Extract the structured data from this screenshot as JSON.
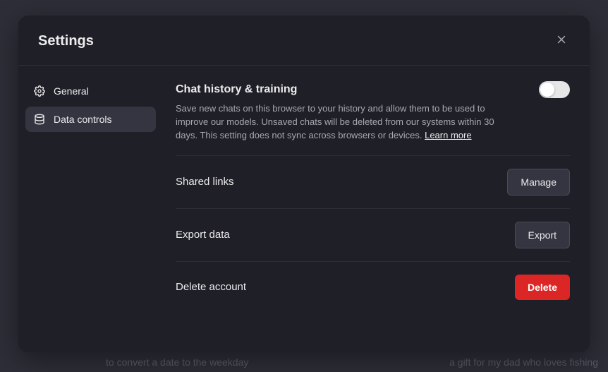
{
  "backdrop": {
    "left": "to convert a date to the weekday",
    "right": "a gift for my dad who loves fishing"
  },
  "modal": {
    "title": "Settings"
  },
  "sidebar": {
    "items": [
      {
        "label": "General"
      },
      {
        "label": "Data controls"
      }
    ]
  },
  "content": {
    "chat_history": {
      "title": "Chat history & training",
      "description": "Save new chats on this browser to your history and allow them to be used to improve our models. Unsaved chats will be deleted from our systems within 30 days. This setting does not sync across browsers or devices. ",
      "learn_more": "Learn more",
      "toggle_on": false
    },
    "shared_links": {
      "title": "Shared links",
      "button": "Manage"
    },
    "export_data": {
      "title": "Export data",
      "button": "Export"
    },
    "delete_account": {
      "title": "Delete account",
      "button": "Delete"
    }
  }
}
